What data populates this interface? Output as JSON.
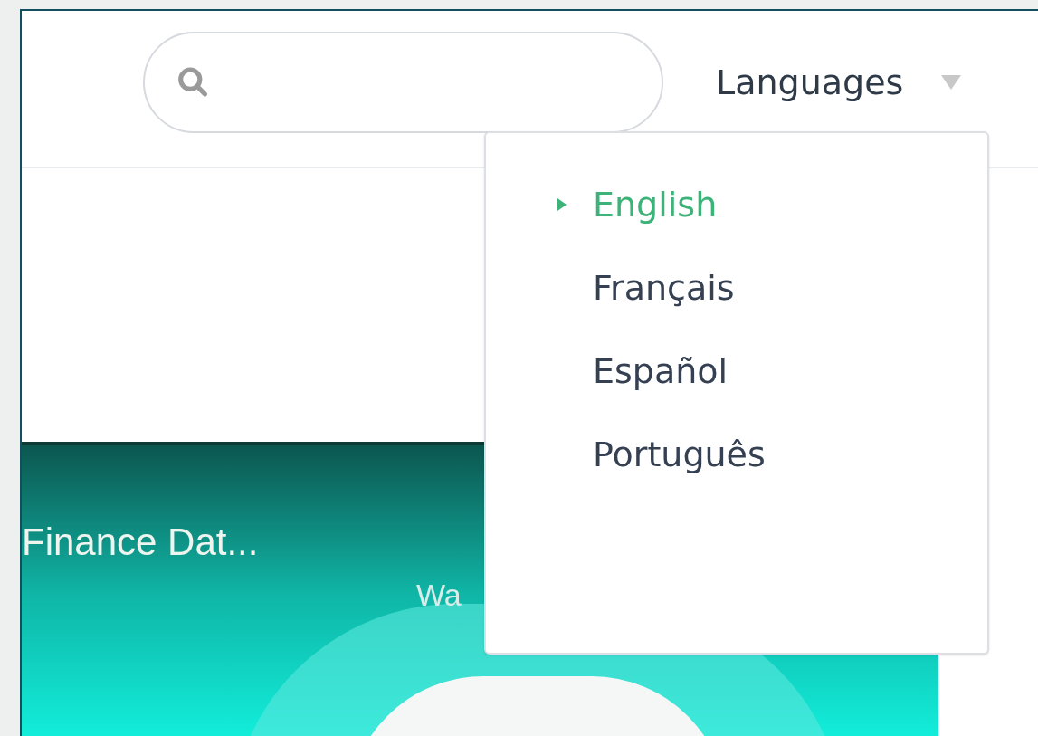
{
  "header": {
    "language_menu": {
      "label": "Languages",
      "expanded": true,
      "items": [
        {
          "label": "English",
          "selected": true
        },
        {
          "label": "Français",
          "selected": false
        },
        {
          "label": "Español",
          "selected": false
        },
        {
          "label": "Português",
          "selected": false
        }
      ]
    }
  },
  "banner": {
    "title": "Finance Dat...",
    "subtitle": "Wa"
  }
}
